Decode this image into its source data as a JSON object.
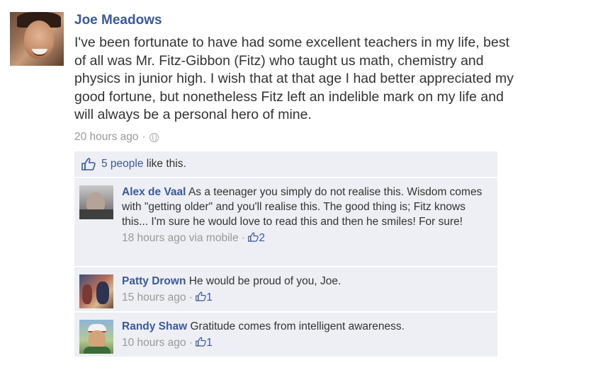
{
  "post": {
    "author": "Joe Meadows",
    "text": "I've been fortunate to have had some excellent teachers in my life, best\nof all was Mr. Fitz-Gibbon (Fitz) who taught us math, chemistry and\nphysics in junior high. I wish that at that age I had better appreciated my\ngood fortune, but nonetheless Fitz left an indelible mark on my life and\nwill always be a personal hero of mine.",
    "timestamp": "20 hours ago",
    "separator": "·",
    "privacy_icon": "globe-icon"
  },
  "likes": {
    "count_text": "5 people",
    "suffix": "like this.",
    "icon": "thumbs-up-icon"
  },
  "comments": [
    {
      "author": "Alex de Vaal",
      "text": "As a teenager you simply do not realise this. Wisdom comes with \"getting older\" and you'll realise this. The good thing is; Fitz knows this... I'm sure he would love to read this and then he smiles! For sure!",
      "timestamp": "18 hours ago via mobile",
      "likes": "2"
    },
    {
      "author": "Patty Drown",
      "text": "He would be proud of you, Joe.",
      "timestamp": "15 hours ago",
      "likes": "1"
    },
    {
      "author": "Randy Shaw",
      "text": "Gratitude comes from intelligent awareness.",
      "timestamp": "10 hours ago",
      "likes": "1"
    }
  ],
  "colors": {
    "link": "#3b5998",
    "meta": "#999999",
    "ufi_bg": "#edeff4"
  }
}
